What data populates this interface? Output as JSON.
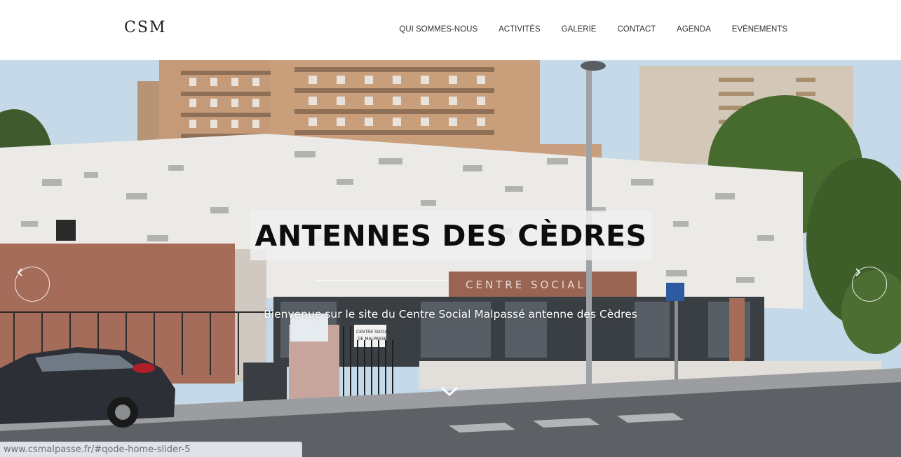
{
  "header": {
    "logo": "CSM",
    "nav": [
      {
        "label": "QUI SOMMES-NOUS"
      },
      {
        "label": "ACTIVITÉS"
      },
      {
        "label": "GALERIE"
      },
      {
        "label": "CONTACT"
      },
      {
        "label": "AGENDA"
      },
      {
        "label": "EVÉNEMENTS"
      }
    ]
  },
  "hero": {
    "title": "ANTENNES DES CÈDRES",
    "subtitle": "Bienvenue sur le site du Centre Social Malpassé antenne des Cèdres",
    "building_sign": "CENTRE     SOCIAL",
    "gate_sign": "CENTRE SOCIAL DE MALPASSE",
    "prev_icon": "chevron-left-icon",
    "next_icon": "chevron-right-icon",
    "scroll_icon": "chevron-down-icon"
  },
  "status_bar": {
    "url": "www.csmalpasse.fr/#qode-home-slider-5"
  },
  "colors": {
    "sky": "#bcd3e6",
    "tower": "#c79c78",
    "building_wall": "#ecebe8",
    "brick": "#a56c5a",
    "road": "#5b5f63"
  }
}
